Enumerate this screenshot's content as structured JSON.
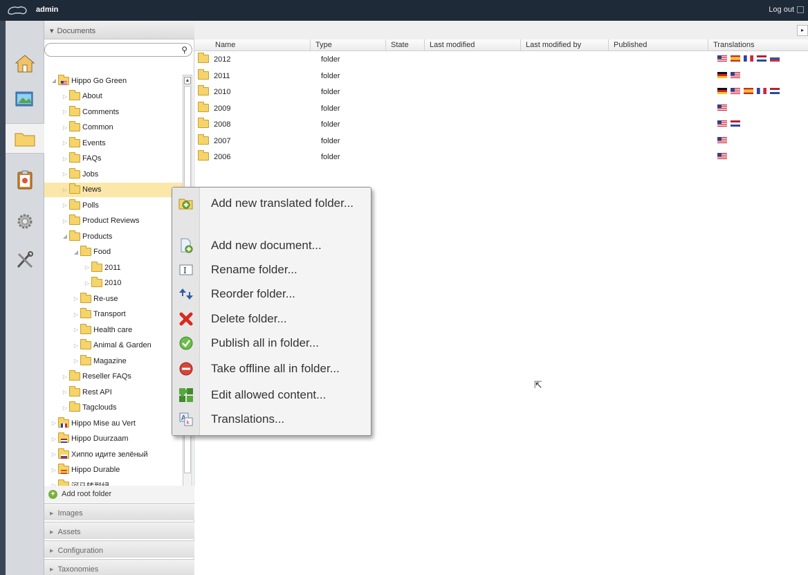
{
  "topbar": {
    "user": "admin",
    "logout": "Log out"
  },
  "nav": {
    "header": "Documents",
    "search": {
      "value": "",
      "placeholder": ""
    },
    "tree": [
      {
        "label": "Hippo Go Green",
        "depth": 0,
        "expanded": true,
        "flag": "us"
      },
      {
        "label": "About",
        "depth": 1
      },
      {
        "label": "Comments",
        "depth": 1
      },
      {
        "label": "Common",
        "depth": 1
      },
      {
        "label": "Events",
        "depth": 1
      },
      {
        "label": "FAQs",
        "depth": 1
      },
      {
        "label": "Jobs",
        "depth": 1
      },
      {
        "label": "News",
        "depth": 1,
        "selected": true
      },
      {
        "label": "Polls",
        "depth": 1
      },
      {
        "label": "Product Reviews",
        "depth": 1
      },
      {
        "label": "Products",
        "depth": 1,
        "expanded": true
      },
      {
        "label": "Food",
        "depth": 2,
        "expanded": true
      },
      {
        "label": "2011",
        "depth": 3
      },
      {
        "label": "2010",
        "depth": 3
      },
      {
        "label": "Re-use",
        "depth": 2
      },
      {
        "label": "Transport",
        "depth": 2
      },
      {
        "label": "Health care",
        "depth": 2
      },
      {
        "label": "Animal & Garden",
        "depth": 2
      },
      {
        "label": "Magazine",
        "depth": 2
      },
      {
        "label": "Reseller FAQs",
        "depth": 1
      },
      {
        "label": "Rest API",
        "depth": 1
      },
      {
        "label": "Tagclouds",
        "depth": 1
      },
      {
        "label": "Hippo Mise au Vert",
        "depth": 0,
        "flag": "fr"
      },
      {
        "label": "Hippo Duurzaam",
        "depth": 0,
        "flag": "nl"
      },
      {
        "label": "Хиппо идите зелёный",
        "depth": 0,
        "flag": "ru"
      },
      {
        "label": "Hippo Durable",
        "depth": 0,
        "flag": "es"
      },
      {
        "label": "河马转到绿",
        "depth": 0,
        "flag": "cn"
      }
    ],
    "add_root": "Add root folder",
    "sections": [
      "Images",
      "Assets",
      "Configuration",
      "Taxonomies"
    ]
  },
  "table": {
    "columns": [
      "Name",
      "Type",
      "State",
      "Last modified",
      "Last modified by",
      "Published",
      "Translations"
    ],
    "rows": [
      {
        "name": "2012",
        "type": "folder",
        "flags": [
          "us",
          "es",
          "fr",
          "nl",
          "ru"
        ]
      },
      {
        "name": "2011",
        "type": "folder",
        "flags": [
          "de",
          "us"
        ]
      },
      {
        "name": "2010",
        "type": "folder",
        "flags": [
          "de",
          "us",
          "es",
          "fr",
          "nl"
        ]
      },
      {
        "name": "2009",
        "type": "folder",
        "flags": [
          "us"
        ]
      },
      {
        "name": "2008",
        "type": "folder",
        "flags": [
          "us",
          "nl"
        ]
      },
      {
        "name": "2007",
        "type": "folder",
        "flags": [
          "us"
        ]
      },
      {
        "name": "2006",
        "type": "folder",
        "flags": [
          "us"
        ]
      }
    ]
  },
  "context_menu": {
    "items": [
      {
        "label": "Add new translated folder...",
        "icon": "add-translated-folder-icon"
      },
      {
        "label": "Add new document...",
        "icon": "add-document-icon"
      },
      {
        "label": "Rename folder...",
        "icon": "rename-icon"
      },
      {
        "label": "Reorder folder...",
        "icon": "reorder-icon"
      },
      {
        "label": "Delete folder...",
        "icon": "delete-icon"
      },
      {
        "label": "Publish all in folder...",
        "icon": "publish-icon"
      },
      {
        "label": "Take offline all in folder...",
        "icon": "take-offline-icon"
      },
      {
        "label": "Edit allowed content...",
        "icon": "puzzle-icon"
      },
      {
        "label": "Translations...",
        "icon": "translations-icon"
      }
    ]
  },
  "colors": {
    "topbar": "#1f2a38",
    "selected_row": "#fbe7a9",
    "folder": "#f4d46b"
  }
}
